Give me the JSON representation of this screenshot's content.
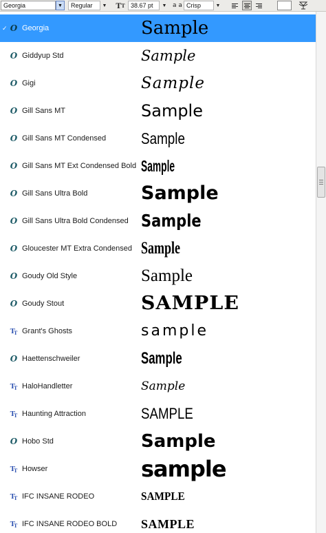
{
  "toolbar": {
    "font_family": "Georgia",
    "font_style": "Regular",
    "font_size": "38.67 pt",
    "antialias": "Crisp",
    "antialias_icon_label": "a a"
  },
  "fonts": [
    {
      "name": "Georgia",
      "icon": "opentype-icon",
      "sample": "Sample",
      "selected": true
    },
    {
      "name": "Giddyup Std",
      "icon": "opentype-icon",
      "sample": "Sample"
    },
    {
      "name": "Gigi",
      "icon": "opentype-icon",
      "sample": "Sample"
    },
    {
      "name": "Gill Sans MT",
      "icon": "opentype-icon",
      "sample": "Sample"
    },
    {
      "name": "Gill Sans MT Condensed",
      "icon": "opentype-icon",
      "sample": "Sample"
    },
    {
      "name": "Gill Sans MT Ext Condensed Bold",
      "icon": "opentype-icon",
      "sample": "Sample"
    },
    {
      "name": "Gill Sans Ultra Bold",
      "icon": "opentype-icon",
      "sample": "Sample"
    },
    {
      "name": "Gill Sans Ultra Bold Condensed",
      "icon": "opentype-icon",
      "sample": "Sample"
    },
    {
      "name": "Gloucester MT Extra Condensed",
      "icon": "opentype-icon",
      "sample": "Sample"
    },
    {
      "name": "Goudy Old Style",
      "icon": "opentype-icon",
      "sample": "Sample"
    },
    {
      "name": "Goudy Stout",
      "icon": "opentype-icon",
      "sample": "SAMPLE"
    },
    {
      "name": "Grant's Ghosts",
      "icon": "truetype-icon",
      "sample": "sample"
    },
    {
      "name": "Haettenschweiler",
      "icon": "opentype-icon",
      "sample": "Sample"
    },
    {
      "name": "HaloHandletter",
      "icon": "truetype-icon",
      "sample": "Sample"
    },
    {
      "name": "Haunting Attraction",
      "icon": "truetype-icon",
      "sample": "SAMPLE"
    },
    {
      "name": "Hobo Std",
      "icon": "opentype-icon",
      "sample": "Sample"
    },
    {
      "name": "Howser",
      "icon": "truetype-icon",
      "sample": "sample"
    },
    {
      "name": "IFC INSANE RODEO",
      "icon": "truetype-icon",
      "sample": "SAMPLE"
    },
    {
      "name": "IFC INSANE RODEO BOLD",
      "icon": "truetype-icon",
      "sample": "SAMPLE"
    }
  ]
}
